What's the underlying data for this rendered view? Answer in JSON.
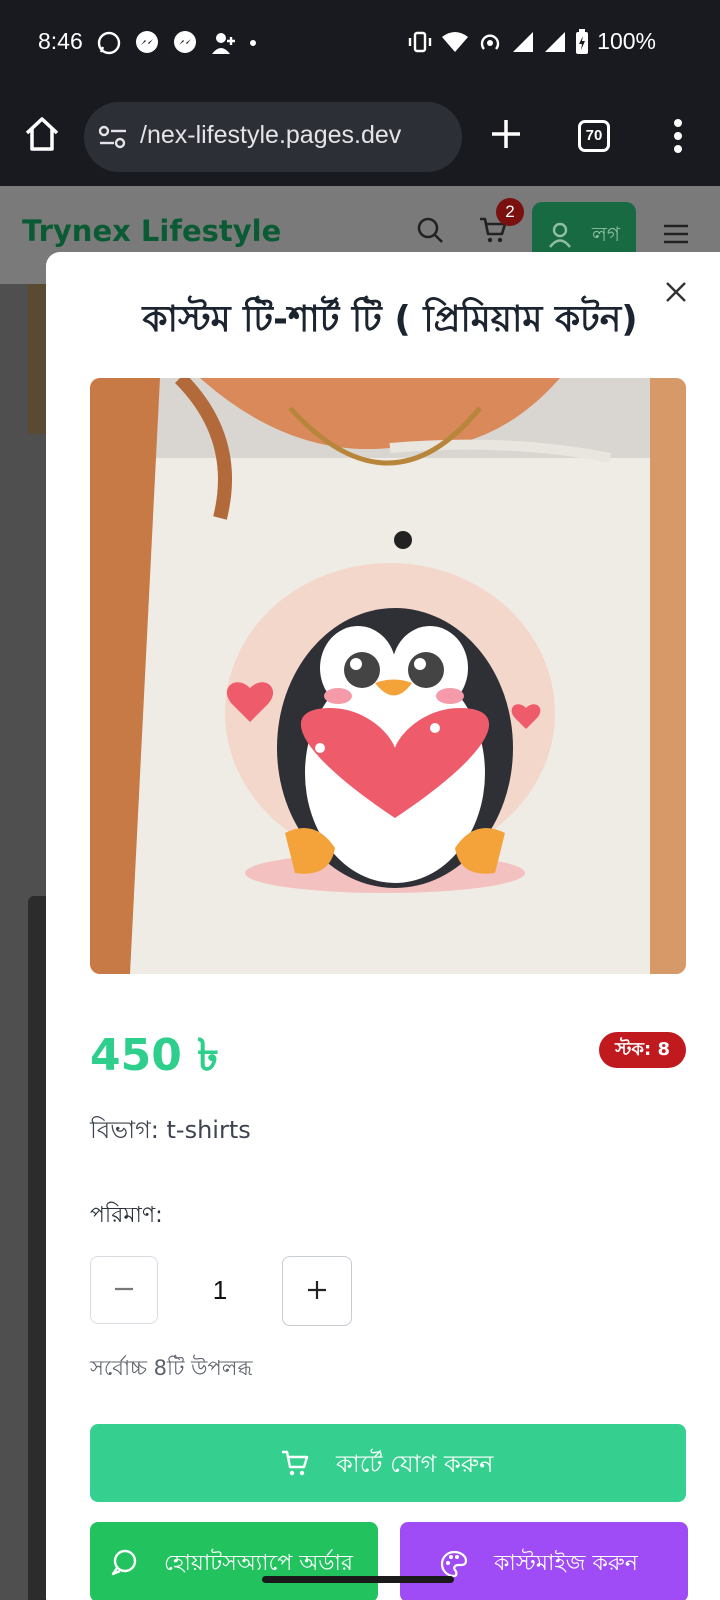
{
  "status_bar": {
    "time": "8:46",
    "battery": "100%"
  },
  "browser": {
    "url": "/nex-lifestyle.pages.dev",
    "tab_count": "70"
  },
  "site": {
    "brand": "Trynex Lifestyle",
    "cart_count": "2",
    "login_label": "লগ"
  },
  "modal": {
    "title": "কাস্টম টি-শার্ট টি ( প্রিমিয়াম কটন)",
    "price": "450 ৳",
    "stock": "স্টক: 8",
    "category": "বিভাগ: t-shirts",
    "quantity_label": "পরিমাণ:",
    "quantity_value": "1",
    "max_note": "সর্বোচ্চ 8টি উপলব্ধ",
    "add_to_cart": "কার্টে যোগ করুন",
    "whatsapp_order": "হোয়াটসঅ্যাপে অর্ডার",
    "customize": "কাস্টমাইজ করুন"
  },
  "colors": {
    "price": "#2ecf8c",
    "cart_button": "#35d08f",
    "whatsapp_button": "#22c35e",
    "customize_button": "#a04cf6",
    "stock_badge": "#c0191e"
  }
}
